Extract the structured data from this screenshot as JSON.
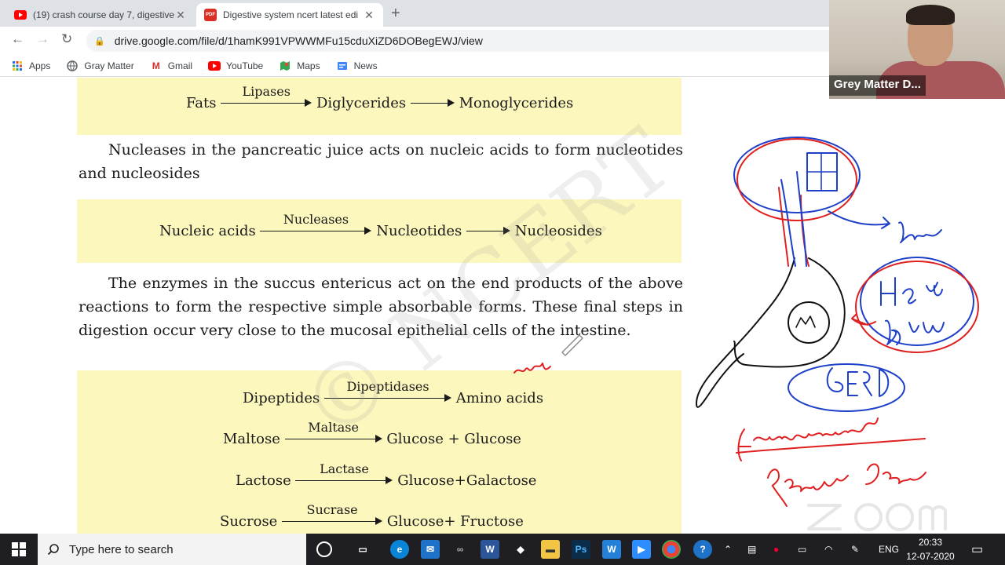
{
  "tabs": [
    {
      "title": "(19) crash course day 7, digestive",
      "active": false,
      "favicon": "youtube-icon"
    },
    {
      "title": "Digestive system ncert latest edi",
      "active": true,
      "favicon": "pdf-icon"
    }
  ],
  "address_bar": {
    "url": "drive.google.com/file/d/1hamK991VPWWMFu15cduXiZD6DOBegEWJ/view"
  },
  "bookmarks": [
    {
      "label": "Apps",
      "icon": "apps-grid-icon"
    },
    {
      "label": "Gray Matter",
      "icon": "globe-icon"
    },
    {
      "label": "Gmail",
      "icon": "gmail-icon"
    },
    {
      "label": "YouTube",
      "icon": "youtube-icon"
    },
    {
      "label": "Maps",
      "icon": "maps-icon"
    },
    {
      "label": "News",
      "icon": "news-icon"
    }
  ],
  "document": {
    "eq_fats": {
      "left": "Fats",
      "enzyme": "Lipases",
      "mid": "Diglycerides",
      "right": "Monoglycerides"
    },
    "para1": "Nucleases in the pancreatic juice acts on nucleic acids to form nucleotides and nucleosides",
    "eq_nucleic": {
      "left": "Nucleic acids",
      "enzyme": "Nucleases",
      "mid": "Nucleotides",
      "right": "Nucleosides"
    },
    "para2": "The enzymes  in the succus entericus act on the end products of the above reactions to form the respective simple absorbable forms. These final steps in digestion occur very close to the mucosal epithelial cells of the intestine.",
    "final_eqs": [
      {
        "left": "Dipeptides",
        "enzyme": "Dipeptidases",
        "right": "Amino acids"
      },
      {
        "left": "Maltose",
        "enzyme": "Maltase",
        "right": "Glucose + Glucose"
      },
      {
        "left": "Lactose",
        "enzyme": "Lactase",
        "right": "Glucose+Galactose"
      },
      {
        "left": "Sucrose",
        "enzyme": "Sucrase",
        "right": "Glucose+ Fructose"
      }
    ]
  },
  "video": {
    "participant_name": "Grey Matter D..."
  },
  "taskbar": {
    "search_placeholder": "Type here to search",
    "language": "ENG",
    "time": "20:33",
    "date": "12-07-2020"
  }
}
